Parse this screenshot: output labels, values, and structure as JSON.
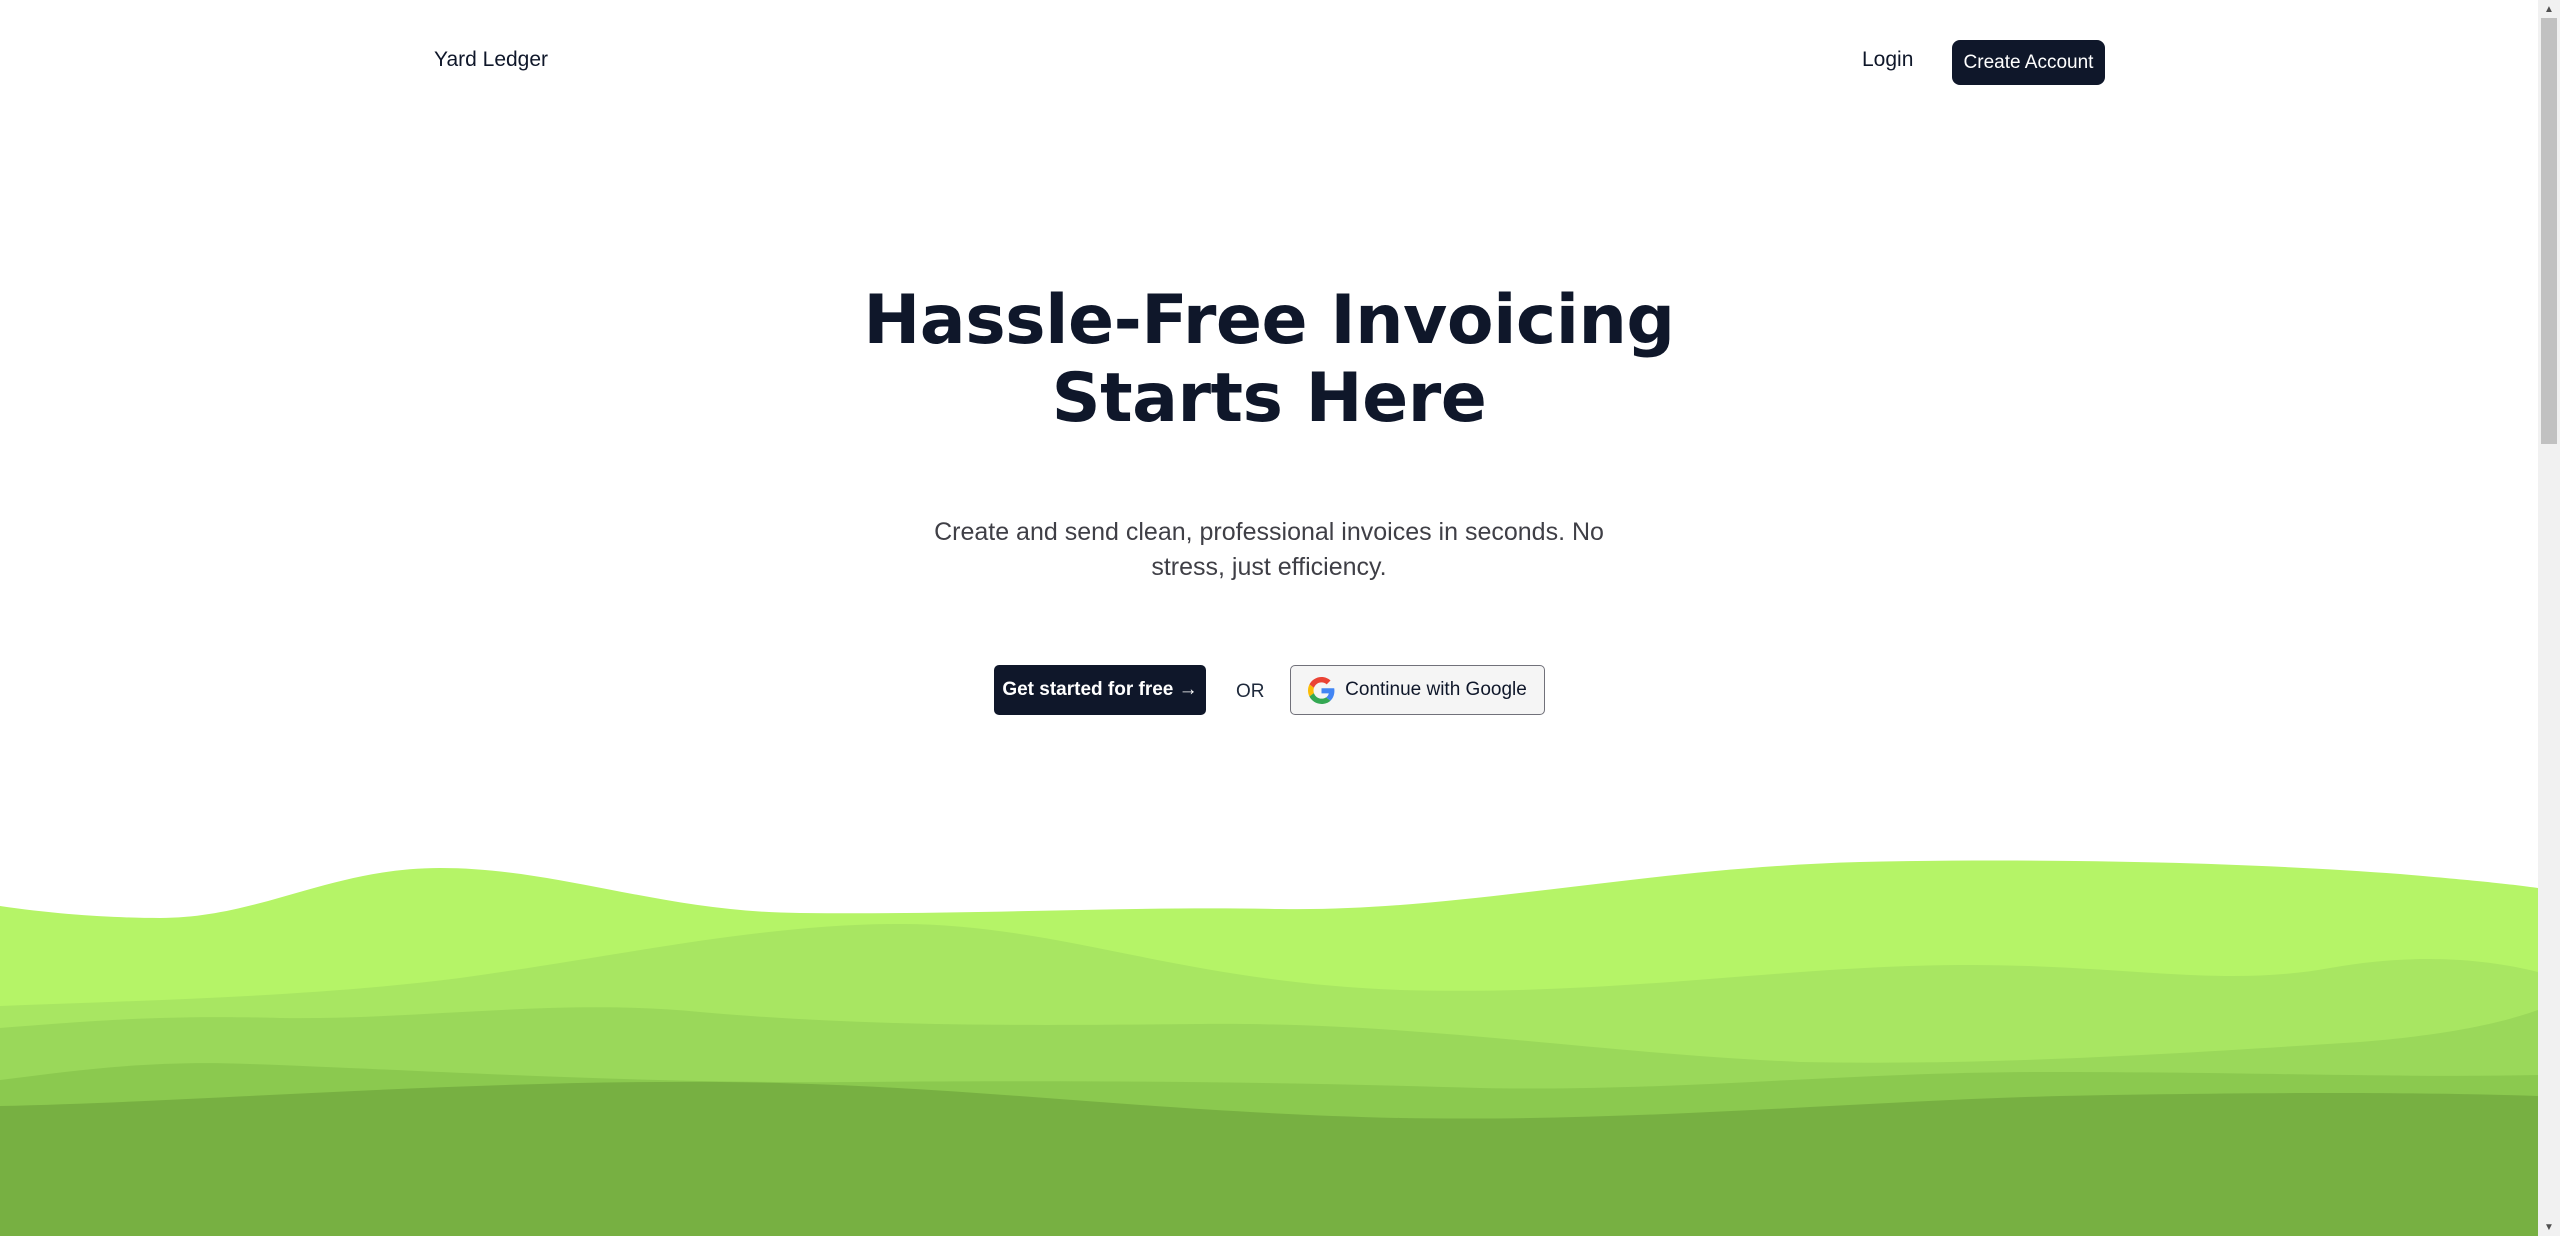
{
  "nav": {
    "brand": "Yard Ledger",
    "login_label": "Login",
    "create_account_label": "Create Account"
  },
  "hero": {
    "title_line1": "Hassle-Free Invoicing",
    "title_line2": "Starts Here",
    "subtitle": "Create and send clean, professional invoices in seconds. No stress, just efficiency.",
    "primary_cta": "Get started for free →",
    "or_text": "OR",
    "google_cta": "Continue with Google",
    "google_icon": "google-icon"
  },
  "colors": {
    "primary": "#0f172a",
    "hill_back": "#b5f467",
    "hill_2": "#a8e662",
    "hill_3": "#9ad85a",
    "hill_4": "#8bc94f",
    "hill_front": "#77b042"
  }
}
